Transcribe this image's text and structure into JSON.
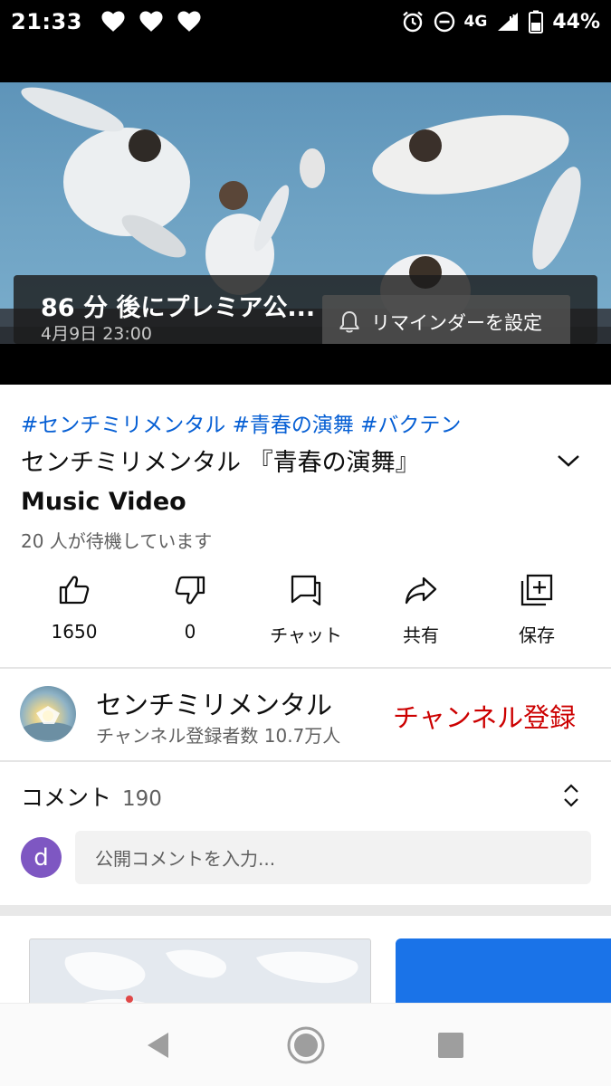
{
  "status_bar": {
    "time": "21:33",
    "network": "4G",
    "battery": "44%",
    "icons": [
      "heart-icon",
      "heart-icon",
      "heart-icon",
      "alarm-icon",
      "do-not-disturb-icon",
      "signal-icon",
      "battery-icon"
    ]
  },
  "video": {
    "premiere_text": "86 分 後にプレミア公...",
    "premiere_date": "4月9日 23:00",
    "reminder_label": "リマインダーを設定"
  },
  "details": {
    "hashtags": "#センチミリメンタル #青春の演舞 #バクテン",
    "title_line1": "センチミリメンタル 『青春の演舞』",
    "title_line2": "Music Video",
    "waiting": "20 人が待機しています"
  },
  "actions": {
    "like": "1650",
    "dislike": "0",
    "chat": "チャット",
    "share": "共有",
    "save": "保存"
  },
  "channel": {
    "name": "センチミリメンタル",
    "subscribers": "チャンネル登録者数 10.7万人",
    "subscribe_label": "チャンネル登録"
  },
  "comments": {
    "header": "コメント",
    "count": "190",
    "avatar_letter": "d",
    "placeholder": "公開コメントを入力..."
  },
  "colors": {
    "link": "#065fd4",
    "subscribe": "#cc0000",
    "comment_avatar": "#7e57c2",
    "card_blue": "#1a73e8"
  }
}
